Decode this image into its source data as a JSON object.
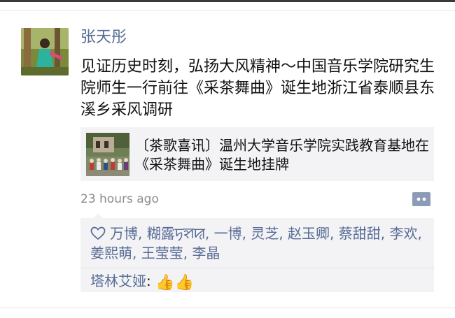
{
  "post": {
    "author": "张天彤",
    "text": "见证历史时刻，弘扬大风精神～中国音乐学院研究生院师生一行前往《采茶舞曲》诞生地浙江省泰顺县东溪乡采风调研",
    "link": {
      "title": "〔茶歌喜讯〕温州大学音乐学院实践教育基地在《采茶舞曲》诞生地挂牌"
    },
    "timestamp": "23 hours ago"
  },
  "likes": {
    "names": [
      "万博",
      "糊露ꠠꠡꠢ",
      "一博",
      "灵芝",
      "赵玉卿",
      "蔡甜甜",
      "李欢",
      "姜熙萌",
      "王莹莹",
      "李晶"
    ],
    "separator": ", "
  },
  "comments": [
    {
      "author": "塔林艾娅",
      "colon": ": ",
      "emoji": "👍👍"
    }
  ],
  "colors": {
    "name_link": "#576b95",
    "timestamp": "#8c8c8c",
    "card_bg": "#f3f3f5",
    "text": "#111111"
  },
  "icons": {
    "like": "heart-outline-icon",
    "comment": "comment-dots-icon"
  }
}
